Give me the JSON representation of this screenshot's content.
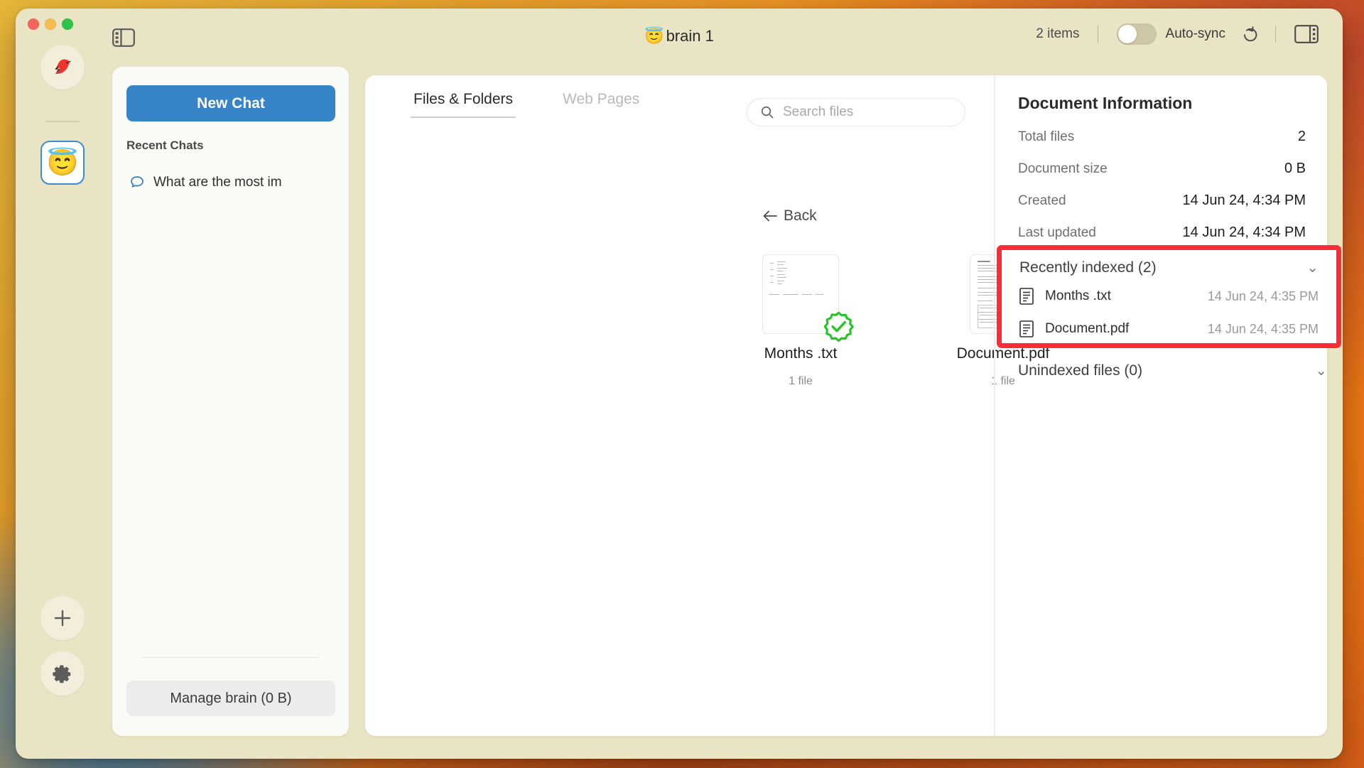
{
  "window": {
    "title": "brain 1",
    "title_emoji": "😇",
    "traffic_lights": [
      "close",
      "minimize",
      "maximize"
    ]
  },
  "toolbar": {
    "sidebar_toggle_icon": "sidebar-left-icon",
    "items_count": "2 items",
    "autosync_label": "Auto-sync",
    "autosync_on": false,
    "refresh_icon": "refresh-icon",
    "panel_toggle_icon": "sidebar-right-icon"
  },
  "rail": {
    "app_logo_icon": "red-bird-logo",
    "brain_avatar_emoji": "😇",
    "add_button_icon": "plus-icon",
    "settings_button_icon": "gear-icon"
  },
  "chat_sidebar": {
    "new_chat_label": "New Chat",
    "recent_chats_label": "Recent Chats",
    "recent_chats": [
      {
        "icon": "chat-bubble-icon",
        "title": "What are the most im"
      }
    ],
    "manage_brain_label": "Manage brain (0 B)"
  },
  "content": {
    "tabs": [
      {
        "label": "Files & Folders",
        "active": true
      },
      {
        "label": "Web Pages",
        "active": false
      }
    ],
    "search": {
      "placeholder": "Search files",
      "value": "",
      "icon": "search-icon"
    },
    "back_label": "Back",
    "back_icon": "arrow-left-icon",
    "files": [
      {
        "name": "Months .txt",
        "sub": "1 file",
        "indexed": true,
        "thumb": "text-document"
      },
      {
        "name": "Document.pdf",
        "sub": "1 file",
        "indexed": true,
        "thumb": "pdf-document"
      }
    ]
  },
  "info_panel": {
    "title": "Document Information",
    "rows": [
      {
        "key": "Total files",
        "value": "2"
      },
      {
        "key": "Document size",
        "value": "0 B"
      },
      {
        "key": "Created",
        "value": "14 Jun 24, 4:34 PM"
      },
      {
        "key": "Last updated",
        "value": "14 Jun 24, 4:34 PM"
      }
    ],
    "recently_indexed": {
      "title": "Recently indexed (2)",
      "chevron": "⌄",
      "items": [
        {
          "icon": "document-icon",
          "name": "Months .txt",
          "time": "14 Jun 24, 4:35 PM"
        },
        {
          "icon": "document-icon",
          "name": "Document.pdf",
          "time": "14 Jun 24, 4:35 PM"
        }
      ]
    },
    "unindexed": {
      "title": "Unindexed files (0)",
      "chevron": "⌄"
    },
    "highlight_color": "#fb2c36"
  },
  "colors": {
    "accent_blue": "#3784c6",
    "badge_green": "#22c521",
    "window_chrome": "#e9e4c4",
    "highlight_red": "#fb2c36"
  }
}
